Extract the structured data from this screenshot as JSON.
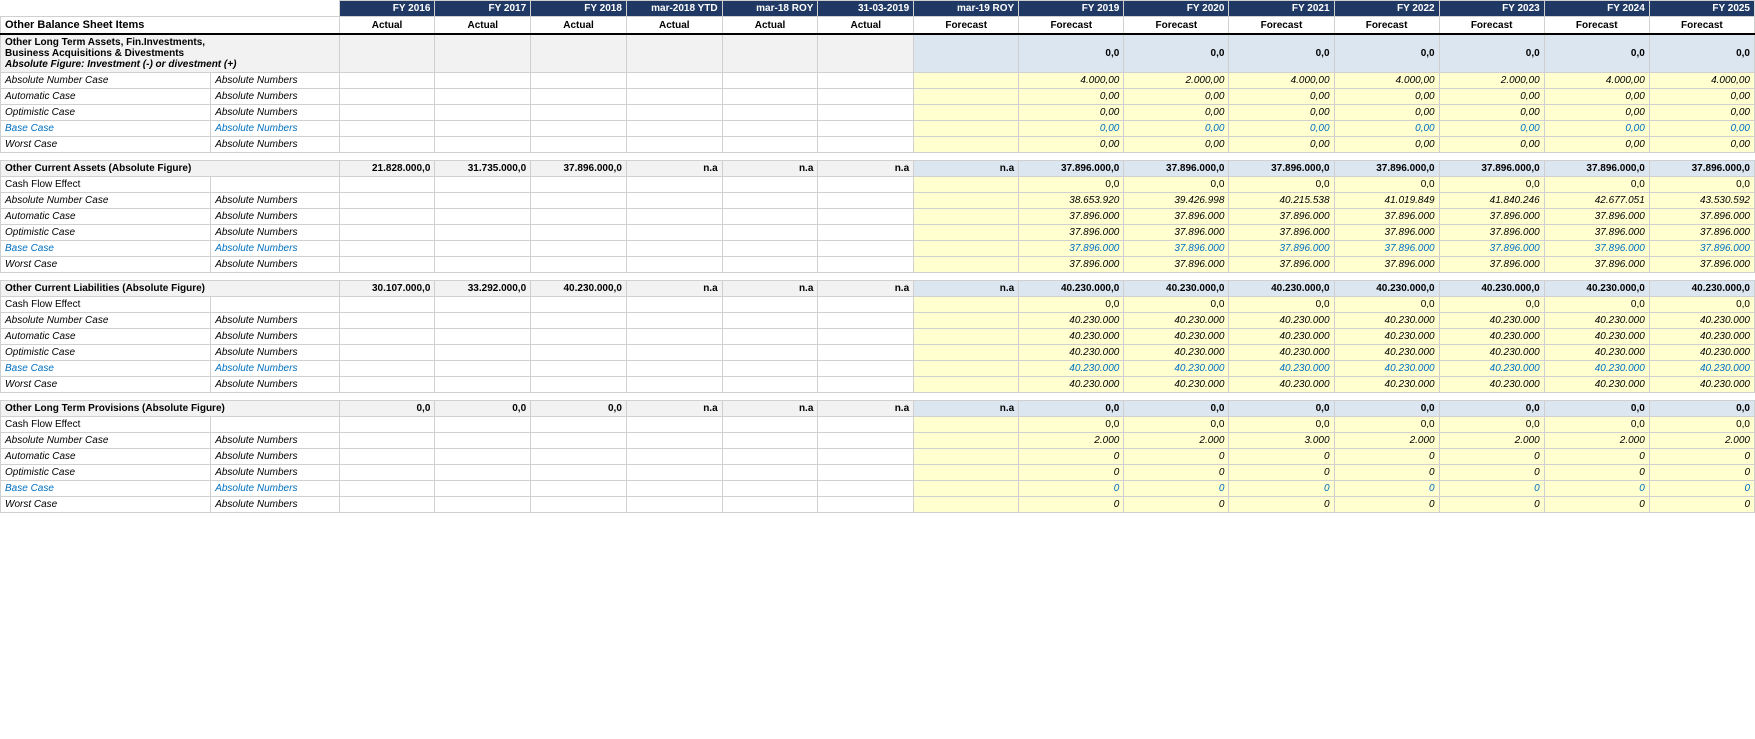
{
  "header": {
    "col_label": "Other Balance Sheet Items",
    "columns": [
      {
        "id": "fy2016",
        "label": "FY 2016",
        "sub": "Actual",
        "type": "actual"
      },
      {
        "id": "fy2017",
        "label": "FY 2017",
        "sub": "Actual",
        "type": "actual"
      },
      {
        "id": "fy2018",
        "label": "FY 2018",
        "sub": "Actual",
        "type": "actual"
      },
      {
        "id": "mar2018ytd",
        "label": "mar-2018 YTD",
        "sub": "Actual",
        "type": "actual"
      },
      {
        "id": "mar18roy",
        "label": "mar-18 ROY",
        "sub": "Actual",
        "type": "actual"
      },
      {
        "id": "d31032019",
        "label": "31-03-2019",
        "sub": "Actual",
        "type": "actual"
      },
      {
        "id": "mar19roy",
        "label": "mar-19 ROY",
        "sub": "Forecast",
        "type": "forecast"
      },
      {
        "id": "fy2019",
        "label": "FY 2019",
        "sub": "Forecast",
        "type": "forecast"
      },
      {
        "id": "fy2020",
        "label": "FY 2020",
        "sub": "Forecast",
        "type": "forecast"
      },
      {
        "id": "fy2021",
        "label": "FY 2021",
        "sub": "Forecast",
        "type": "forecast"
      },
      {
        "id": "fy2022",
        "label": "FY 2022",
        "sub": "Forecast",
        "type": "forecast"
      },
      {
        "id": "fy2023",
        "label": "FY 2023",
        "sub": "Forecast",
        "type": "forecast"
      },
      {
        "id": "fy2024",
        "label": "FY 2024",
        "sub": "Forecast",
        "type": "forecast"
      },
      {
        "id": "fy2025",
        "label": "FY 2025",
        "sub": "Forecast",
        "type": "forecast"
      }
    ]
  },
  "sections": [
    {
      "id": "sec1",
      "title": "Other Long Term Assets, Fin.Investments,",
      "title2": "Business Acquisitions & Divestments",
      "title3": "Absolute Figure:  Investment (-) or divestment (+)",
      "total_row": [
        "",
        "",
        "",
        "",
        "",
        "",
        "",
        "0,0",
        "0,0",
        "0,0",
        "0,0",
        "0,0",
        "0,0",
        "0,0"
      ],
      "rows": [
        {
          "label": "Absolute Number Case",
          "sublabel": "Absolute Numbers",
          "type": "normal",
          "values": [
            "",
            "",
            "",
            "",
            "",
            "",
            "",
            "4.000,00",
            "2.000,00",
            "4.000,00",
            "4.000,00",
            "2.000,00",
            "4.000,00",
            "4.000,00"
          ]
        },
        {
          "label": "Automatic Case",
          "sublabel": "Absolute Numbers",
          "type": "normal",
          "values": [
            "",
            "",
            "",
            "",
            "",
            "",
            "",
            "0,00",
            "0,00",
            "0,00",
            "0,00",
            "0,00",
            "0,00",
            "0,00"
          ]
        },
        {
          "label": "Optimistic Case",
          "sublabel": "Absolute Numbers",
          "type": "normal",
          "values": [
            "",
            "",
            "",
            "",
            "",
            "",
            "",
            "0,00",
            "0,00",
            "0,00",
            "0,00",
            "0,00",
            "0,00",
            "0,00"
          ]
        },
        {
          "label": "Base Case",
          "sublabel": "Absolute Numbers",
          "type": "base",
          "values": [
            "",
            "",
            "",
            "",
            "",
            "",
            "",
            "0,00",
            "0,00",
            "0,00",
            "0,00",
            "0,00",
            "0,00",
            "0,00"
          ]
        },
        {
          "label": "Worst Case",
          "sublabel": "Absolute Numbers",
          "type": "normal",
          "values": [
            "",
            "",
            "",
            "",
            "",
            "",
            "",
            "0,00",
            "0,00",
            "0,00",
            "0,00",
            "0,00",
            "0,00",
            "0,00"
          ]
        }
      ]
    },
    {
      "id": "sec2",
      "title": "Other Current Assets  (Absolute Figure)",
      "total_row": [
        "21.828.000,0",
        "31.735.000,0",
        "37.896.000,0",
        "n.a",
        "n.a",
        "n.a",
        "n.a",
        "37.896.000,0",
        "37.896.000,0",
        "37.896.000,0",
        "37.896.000,0",
        "37.896.000,0",
        "37.896.000,0",
        "37.896.000,0"
      ],
      "cashflow_row": [
        "",
        "",
        "",
        "",
        "",
        "",
        "",
        "0,0",
        "0,0",
        "0,0",
        "0,0",
        "0,0",
        "0,0",
        "0,0"
      ],
      "rows": [
        {
          "label": "Absolute Number Case",
          "sublabel": "Absolute Numbers",
          "type": "normal",
          "values": [
            "",
            "",
            "",
            "",
            "",
            "",
            "",
            "38.653.920",
            "39.426.998",
            "40.215.538",
            "41.019.849",
            "41.840.246",
            "42.677.051",
            "43.530.592"
          ]
        },
        {
          "label": "Automatic Case",
          "sublabel": "Absolute Numbers",
          "type": "normal",
          "values": [
            "",
            "",
            "",
            "",
            "",
            "",
            "",
            "37.896.000",
            "37.896.000",
            "37.896.000",
            "37.896.000",
            "37.896.000",
            "37.896.000",
            "37.896.000"
          ]
        },
        {
          "label": "Optimistic Case",
          "sublabel": "Absolute Numbers",
          "type": "normal",
          "values": [
            "",
            "",
            "",
            "",
            "",
            "",
            "",
            "37.896.000",
            "37.896.000",
            "37.896.000",
            "37.896.000",
            "37.896.000",
            "37.896.000",
            "37.896.000"
          ]
        },
        {
          "label": "Base Case",
          "sublabel": "Absolute Numbers",
          "type": "base",
          "values": [
            "",
            "",
            "",
            "",
            "",
            "",
            "",
            "37.896.000",
            "37.896.000",
            "37.896.000",
            "37.896.000",
            "37.896.000",
            "37.896.000",
            "37.896.000"
          ]
        },
        {
          "label": "Worst Case",
          "sublabel": "Absolute Numbers",
          "type": "normal",
          "values": [
            "",
            "",
            "",
            "",
            "",
            "",
            "",
            "37.896.000",
            "37.896.000",
            "37.896.000",
            "37.896.000",
            "37.896.000",
            "37.896.000",
            "37.896.000"
          ]
        }
      ]
    },
    {
      "id": "sec3",
      "title": "Other Current Liabilities  (Absolute Figure)",
      "total_row": [
        "30.107.000,0",
        "33.292.000,0",
        "40.230.000,0",
        "n.a",
        "n.a",
        "n.a",
        "n.a",
        "40.230.000,0",
        "40.230.000,0",
        "40.230.000,0",
        "40.230.000,0",
        "40.230.000,0",
        "40.230.000,0",
        "40.230.000,0"
      ],
      "cashflow_row": [
        "",
        "",
        "",
        "",
        "",
        "",
        "",
        "0,0",
        "0,0",
        "0,0",
        "0,0",
        "0,0",
        "0,0",
        "0,0"
      ],
      "rows": [
        {
          "label": "Absolute Number Case",
          "sublabel": "Absolute Numbers",
          "type": "normal",
          "values": [
            "",
            "",
            "",
            "",
            "",
            "",
            "",
            "40.230.000",
            "40.230.000",
            "40.230.000",
            "40.230.000",
            "40.230.000",
            "40.230.000",
            "40.230.000"
          ]
        },
        {
          "label": "Automatic Case",
          "sublabel": "Absolute Numbers",
          "type": "normal",
          "values": [
            "",
            "",
            "",
            "",
            "",
            "",
            "",
            "40.230.000",
            "40.230.000",
            "40.230.000",
            "40.230.000",
            "40.230.000",
            "40.230.000",
            "40.230.000"
          ]
        },
        {
          "label": "Optimistic Case",
          "sublabel": "Absolute Numbers",
          "type": "normal",
          "values": [
            "",
            "",
            "",
            "",
            "",
            "",
            "",
            "40.230.000",
            "40.230.000",
            "40.230.000",
            "40.230.000",
            "40.230.000",
            "40.230.000",
            "40.230.000"
          ]
        },
        {
          "label": "Base Case",
          "sublabel": "Absolute Numbers",
          "type": "base",
          "values": [
            "",
            "",
            "",
            "",
            "",
            "",
            "",
            "40.230.000",
            "40.230.000",
            "40.230.000",
            "40.230.000",
            "40.230.000",
            "40.230.000",
            "40.230.000"
          ]
        },
        {
          "label": "Worst Case",
          "sublabel": "Absolute Numbers",
          "type": "normal",
          "values": [
            "",
            "",
            "",
            "",
            "",
            "",
            "",
            "40.230.000",
            "40.230.000",
            "40.230.000",
            "40.230.000",
            "40.230.000",
            "40.230.000",
            "40.230.000"
          ]
        }
      ]
    },
    {
      "id": "sec4",
      "title": "Other Long Term Provisions (Absolute Figure)",
      "total_row": [
        "0,0",
        "0,0",
        "0,0",
        "n.a",
        "n.a",
        "n.a",
        "n.a",
        "0,0",
        "0,0",
        "0,0",
        "0,0",
        "0,0",
        "0,0",
        "0,0"
      ],
      "cashflow_row": [
        "",
        "",
        "",
        "",
        "",
        "",
        "",
        "0,0",
        "0,0",
        "0,0",
        "0,0",
        "0,0",
        "0,0",
        "0,0"
      ],
      "rows": [
        {
          "label": "Absolute Number Case",
          "sublabel": "Absolute Numbers",
          "type": "normal",
          "values": [
            "",
            "",
            "",
            "",
            "",
            "",
            "",
            "2.000",
            "2.000",
            "3.000",
            "2.000",
            "2.000",
            "2.000",
            "2.000"
          ]
        },
        {
          "label": "Automatic Case",
          "sublabel": "Absolute Numbers",
          "type": "normal",
          "values": [
            "",
            "",
            "",
            "",
            "",
            "",
            "",
            "0",
            "0",
            "0",
            "0",
            "0",
            "0",
            "0"
          ]
        },
        {
          "label": "Optimistic Case",
          "sublabel": "Absolute Numbers",
          "type": "normal",
          "values": [
            "",
            "",
            "",
            "",
            "",
            "",
            "",
            "0",
            "0",
            "0",
            "0",
            "0",
            "0",
            "0"
          ]
        },
        {
          "label": "Base Case",
          "sublabel": "Absolute Numbers",
          "type": "base",
          "values": [
            "",
            "",
            "",
            "",
            "",
            "",
            "",
            "0",
            "0",
            "0",
            "0",
            "0",
            "0",
            "0"
          ]
        },
        {
          "label": "Worst Case",
          "sublabel": "Absolute Numbers",
          "type": "normal",
          "values": [
            "",
            "",
            "",
            "",
            "",
            "",
            "",
            "0",
            "0",
            "0",
            "0",
            "0",
            "0",
            "0"
          ]
        }
      ]
    }
  ],
  "labels": {
    "cash_flow_effect": "Cash Flow Effect",
    "absolute_numbers": "Absolute Numbers"
  }
}
